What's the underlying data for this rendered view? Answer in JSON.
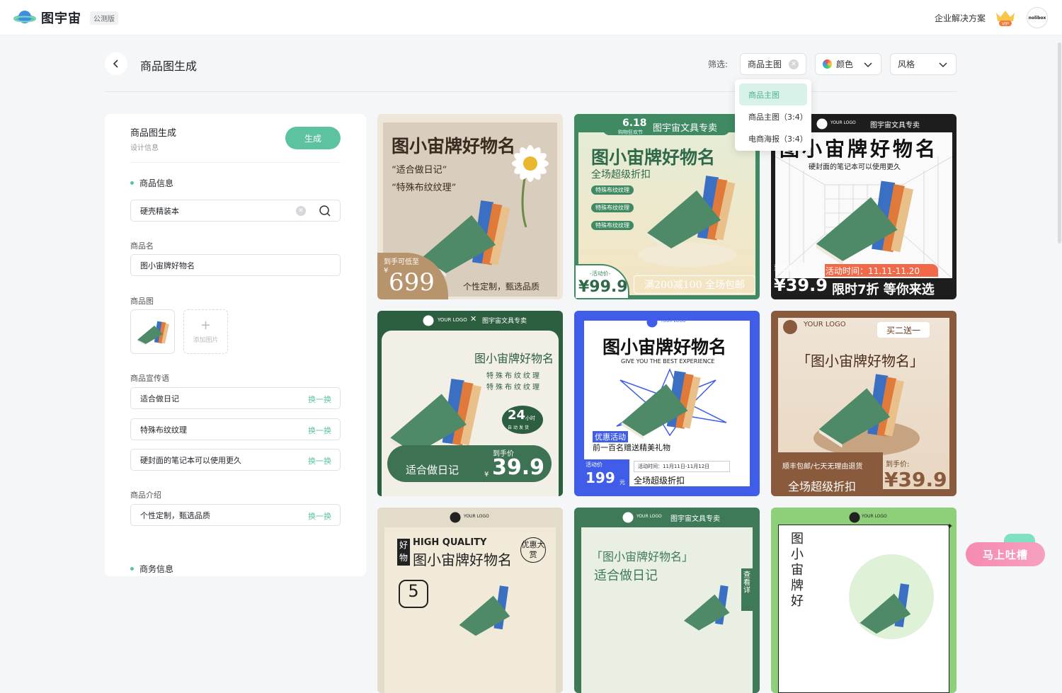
{
  "header": {
    "app_name": "图宇宙",
    "badge": "公测版",
    "enterprise_link": "企业解决方案",
    "vip_label": "VIP",
    "avatar_text": "nolibox"
  },
  "page": {
    "title": "商品图生成",
    "filter_label": "筛选:",
    "filters": {
      "type_value": "商品主图",
      "color_label": "颜色",
      "style_label": "风格"
    },
    "dropdown_options": [
      "商品主图",
      "商品主图（3:4）",
      "电商海报（3:4）"
    ]
  },
  "panel": {
    "title": "商品图生成",
    "subtitle": "设计信息",
    "generate_button": "生成",
    "section_product": "商品信息",
    "search_value": "硬壳精装本",
    "name_label": "商品名",
    "name_value": "图小宙牌好物名",
    "image_label": "商品图",
    "add_image": "添加图片",
    "slogan_label": "商品宣传语",
    "slogans": [
      "适合做日记",
      "特殊布纹纹理",
      "硬封面的笔记本可以使用更久"
    ],
    "swap_label": "换一换",
    "intro_label": "商品介绍",
    "intro_value": "个性定制，甄选品质",
    "section_business": "商务信息"
  },
  "cards": {
    "c1": {
      "title": "图小宙牌好物名",
      "line1": "“适合做日记”",
      "line2": "“特殊布纹纹理”",
      "price_label": "到手可低至",
      "currency": "¥",
      "price": "699",
      "tagline": "个性定制，甄选品质"
    },
    "c2": {
      "date": "6.18",
      "date_sub": "购物狂欢节",
      "brand": "图宇宙文具专卖",
      "title": "图小宙牌好物名",
      "subtitle": "全场超级折扣",
      "tags": [
        "特殊布纹纹理",
        "特殊布纹纹理",
        "特殊布纹纹理"
      ],
      "price_label": "-活动价-",
      "price": "¥99.9",
      "promo": "满200减100 全场包邮"
    },
    "c3": {
      "logo": "YOUR LOGO",
      "brand": "图宇宙文具专卖",
      "title": "图小宙牌好物名",
      "subtitle": "硬封面的笔记本可以使用更久",
      "price_label": "到手价:",
      "event": "活动时间：11.11-11.20",
      "price": "¥39.9",
      "promo": "限时7折  等你来选"
    },
    "c4": {
      "logo": "YOUR LOGO",
      "brand": "图宇宙文具专卖",
      "title": "图小宙牌好物名",
      "line1": "特殊布纹纹理",
      "line2": "特殊布纹纹理",
      "hours": "24",
      "hours_unit": "小时",
      "hours_sub": "自动发货",
      "slogan": "适合做日记",
      "price_label": "到手价",
      "price": "39.9",
      "currency": "¥"
    },
    "c5": {
      "logo": "YOUR LOGO",
      "title": "图小宙牌好物名",
      "subtitle": "GIVE YOU THE BEST EXPERIENCE",
      "promo_tag": "优惠活动",
      "promo_text": "前一百名赠送精美礼物",
      "price_label": "活动价",
      "price": "199",
      "unit": "元",
      "event": "活动时间：11月11日-11月12日",
      "discount": "全场超级折扣"
    },
    "c6": {
      "logo": "YOUR LOGO",
      "tag": "买二送一",
      "title": "「图小宙牌好物名」",
      "service": "顺丰包邮/七天无理由退货",
      "discount": "全场超级折扣",
      "price_label": "到手价:",
      "price": "¥39.9"
    },
    "c7": {
      "logo": "YOUR LOGO",
      "hq": "HIGH QUALITY",
      "title": "图小宙牌好物名",
      "side_left": "好物",
      "side_right": "优惠大赏",
      "number": "5"
    },
    "c8": {
      "logo": "YOUR LOGO",
      "brand": "图宇宙文具专卖",
      "title": "「图小宙牌好物名」",
      "subtitle": "适合做日记",
      "side": "查看详"
    },
    "c9": {
      "logo": "YOUR LOGO",
      "vertical": "图小宙牌好"
    }
  },
  "feedback": "马上吐槽",
  "colors": {
    "accent": "#5cc2a0",
    "accent_light": "#d8f2ea",
    "book_green": "#4e8a68"
  }
}
